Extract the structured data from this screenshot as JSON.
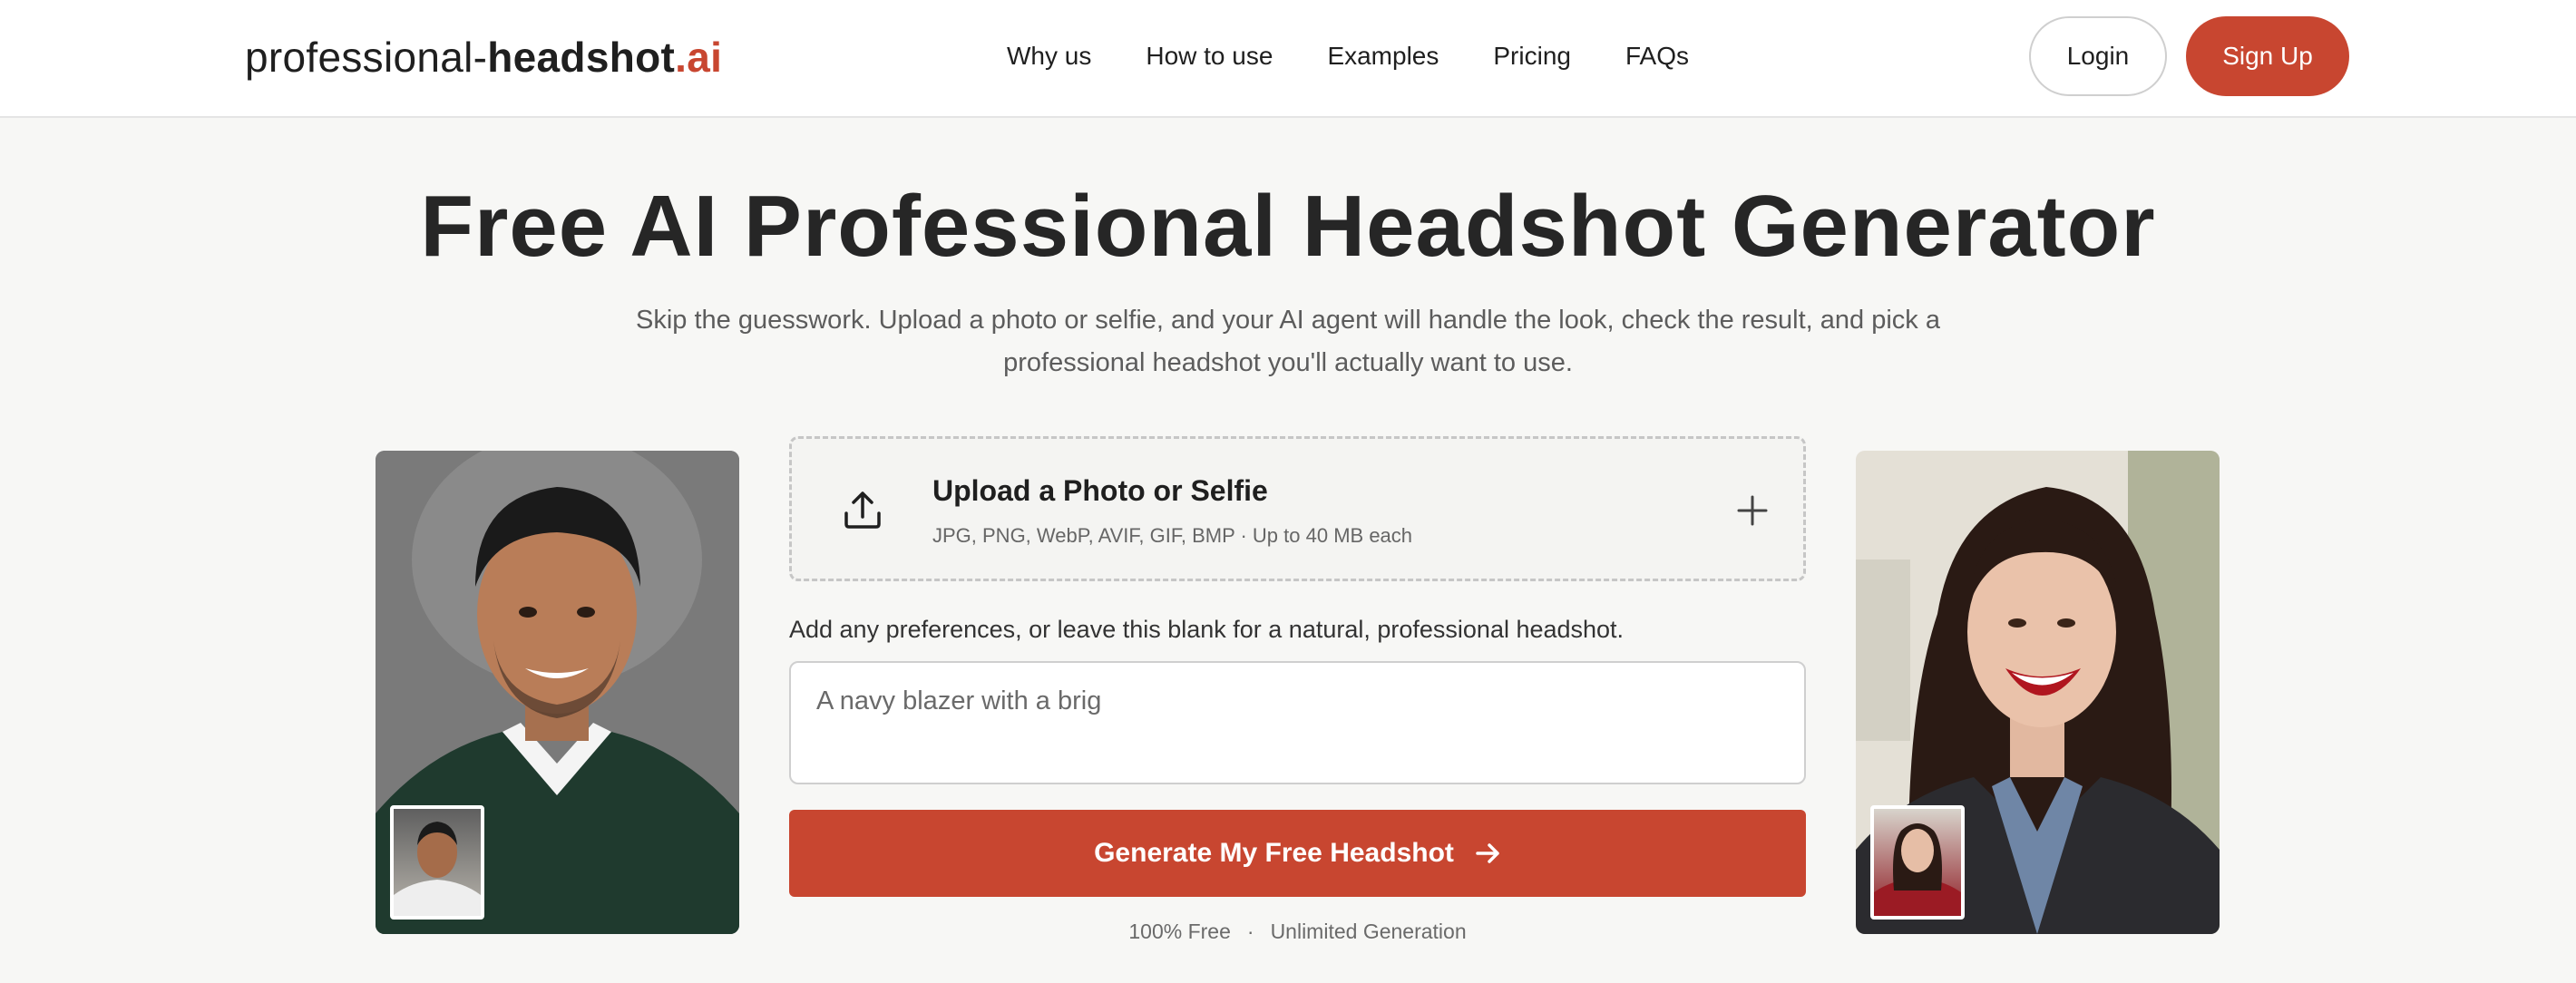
{
  "header": {
    "logo": {
      "part1": "professional-",
      "part2": "headshot",
      "part3": ".ai"
    },
    "nav": [
      "Why us",
      "How to use",
      "Examples",
      "Pricing",
      "FAQs"
    ],
    "login_label": "Login",
    "signup_label": "Sign Up"
  },
  "hero": {
    "title": "Free AI Professional Headshot Generator",
    "subtitle": "Skip the guesswork. Upload a photo or selfie, and your AI agent will handle the look, check the result, and pick a professional headshot you'll actually want to use."
  },
  "upload": {
    "title": "Upload a Photo or Selfie",
    "formats": "JPG, PNG, WebP, AVIF, GIF, BMP · Up to 40 MB each",
    "icon": "upload-icon",
    "add_icon": "plus-icon"
  },
  "preferences": {
    "label": "Add any preferences, or leave this blank for a natural, professional headshot.",
    "value": "A navy blazer with a brig"
  },
  "generate": {
    "label": "Generate My Free Headshot",
    "icon": "arrow-right-icon"
  },
  "footnote": {
    "left": "100% Free",
    "separator": "·",
    "right": "Unlimited Generation"
  },
  "colors": {
    "accent": "#c84630",
    "text": "#1f1f1f",
    "muted": "#5c5c5c",
    "background": "#f7f7f5"
  }
}
